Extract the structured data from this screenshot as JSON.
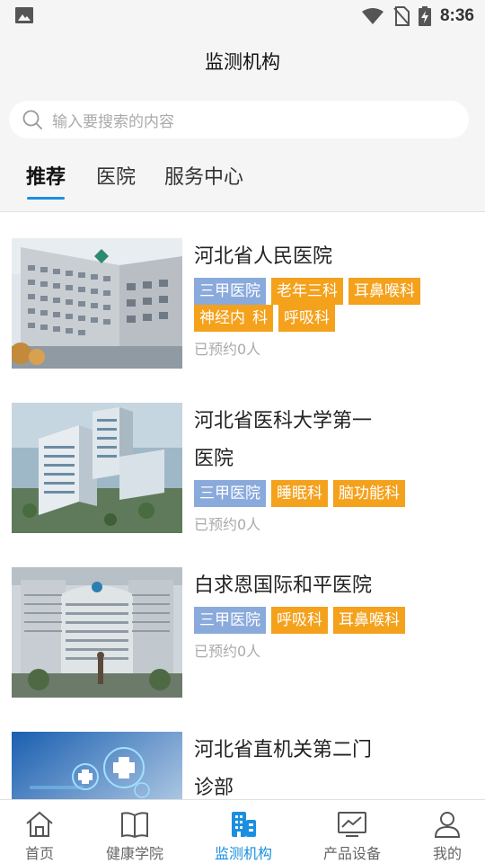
{
  "status_bar": {
    "time": "8:36"
  },
  "header": {
    "title": "监测机构"
  },
  "search": {
    "placeholder": "输入要搜索的内容"
  },
  "tabs": [
    {
      "label": "推荐",
      "active": true
    },
    {
      "label": "医院",
      "active": false
    },
    {
      "label": "服务中心",
      "active": false
    }
  ],
  "institutions": [
    {
      "name": "河北省人民医院",
      "tags": [
        "三甲医院",
        "老年三科",
        "耳鼻喉科",
        "神经内",
        "科",
        "呼吸科"
      ],
      "booked": "已预约0人",
      "image": "hospital-building-photo"
    },
    {
      "name": "河北省医科大学第一",
      "name_line2": "医院",
      "tags": [
        "三甲医院",
        "睡眠科",
        "脑功能科"
      ],
      "booked": "已预约0人",
      "image": "hospital-rendering-photo"
    },
    {
      "name": "白求恩国际和平医院",
      "tags": [
        "三甲医院",
        "呼吸科",
        "耳鼻喉科"
      ],
      "booked": "已预约0人",
      "image": "hospital-statue-photo"
    },
    {
      "name": "河北省直机关第二门",
      "name_line2": "诊部",
      "image": "medical-cross-graphic"
    }
  ],
  "bottom_nav": [
    {
      "label": "首页",
      "icon": "home-icon",
      "active": false
    },
    {
      "label": "健康学院",
      "icon": "book-icon",
      "active": false
    },
    {
      "label": "监测机构",
      "icon": "building-icon",
      "active": true
    },
    {
      "label": "产品设备",
      "icon": "chart-icon",
      "active": false
    },
    {
      "label": "我的",
      "icon": "user-icon",
      "active": false
    }
  ],
  "colors": {
    "accent": "#1a8fe0",
    "grade_tag": "#8aaadc",
    "dept_tag": "#f4a11c",
    "background": "#f5f5f5"
  }
}
